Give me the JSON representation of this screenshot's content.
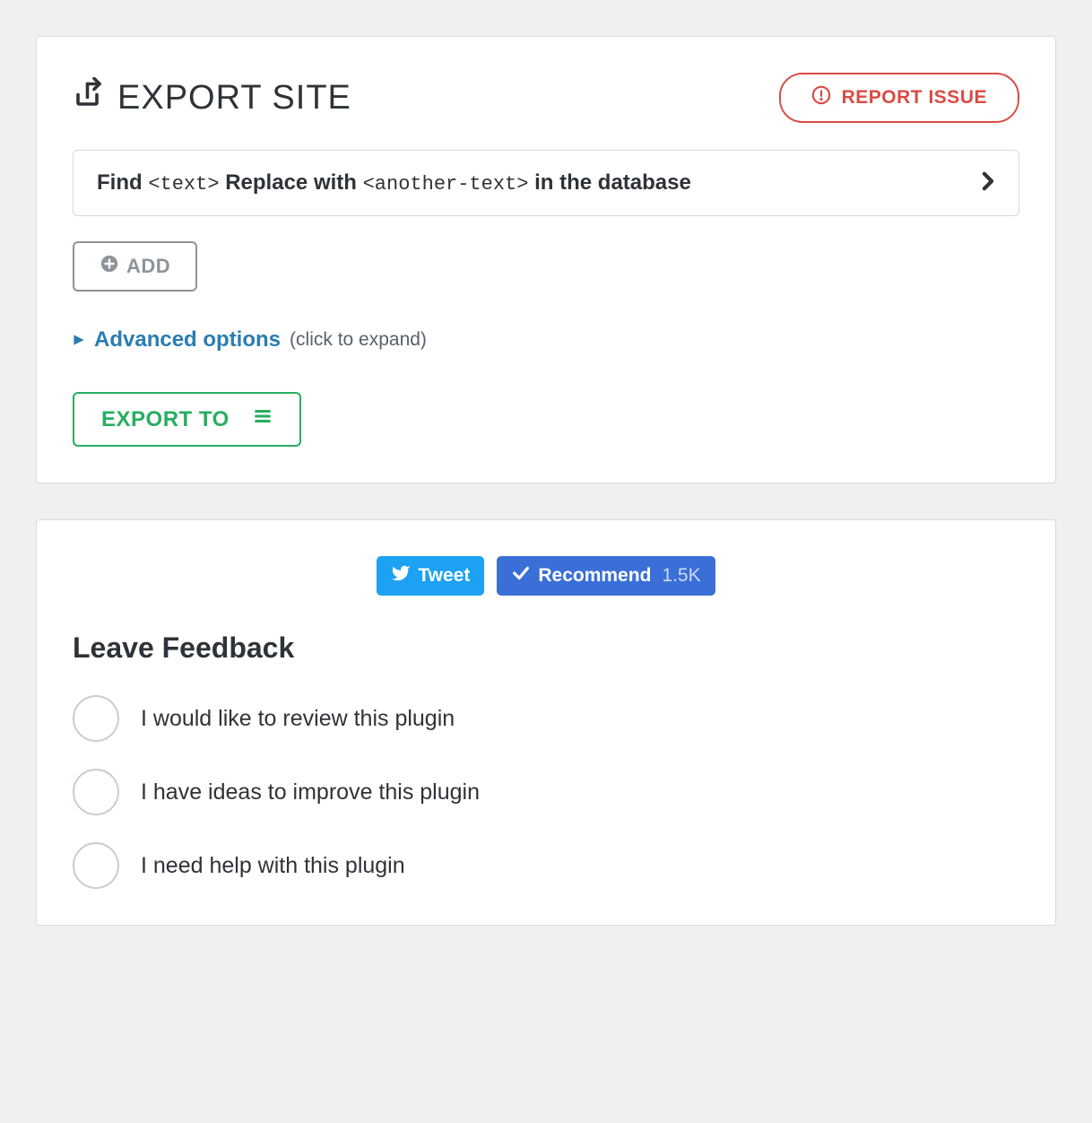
{
  "export": {
    "title": "EXPORT SITE",
    "report_issue_label": "REPORT ISSUE",
    "find_replace": {
      "find_label": "Find",
      "find_placeholder": "<text>",
      "replace_label": "Replace with",
      "replace_placeholder": "<another-text>",
      "suffix": "in the database"
    },
    "add_button_label": "ADD",
    "advanced": {
      "link_label": "Advanced options",
      "hint": "(click to expand)"
    },
    "export_button_label": "EXPORT TO"
  },
  "social": {
    "tweet_label": "Tweet",
    "recommend_label": "Recommend",
    "recommend_count": "1.5K"
  },
  "feedback": {
    "heading": "Leave Feedback",
    "options": [
      {
        "label": "I would like to review this plugin"
      },
      {
        "label": "I have ideas to improve this plugin"
      },
      {
        "label": "I need help with this plugin"
      }
    ]
  }
}
